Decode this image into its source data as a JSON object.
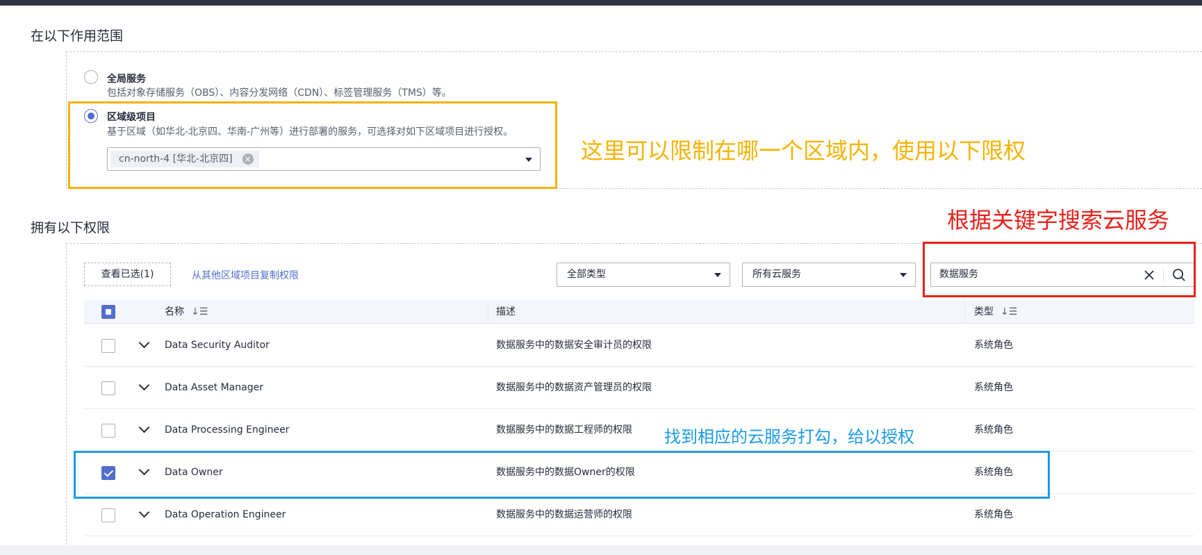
{
  "scope": {
    "title": "在以下作用范围",
    "global_option": {
      "title": "全局服务",
      "desc": "包括对象存储服务（OBS）、内容分发网络（CDN）、标签管理服务（TMS）等。",
      "selected": false
    },
    "region_option": {
      "title": "区域级项目",
      "desc": "基于区域（如华北-北京四、华南-广州等）进行部署的服务，可选择对如下区域项目进行授权。",
      "selected": true,
      "selected_tag": "cn-north-4 [华北-北京四]"
    }
  },
  "permissions": {
    "title": "拥有以下权限",
    "view_selected_button": "查看已选(1)",
    "copy_link": "从其他区域项目复制权限",
    "type_filter": "全部类型",
    "service_filter": "所有云服务",
    "search_value": "数据服务",
    "columns": {
      "name": "名称",
      "desc": "描述",
      "type": "类型"
    },
    "rows": [
      {
        "name": "Data Security Auditor",
        "desc": "数据服务中的数据安全审计员的权限",
        "type": "系统角色",
        "checked": false
      },
      {
        "name": "Data Asset Manager",
        "desc": "数据服务中的数据资产管理员的权限",
        "type": "系统角色",
        "checked": false
      },
      {
        "name": "Data Processing Engineer",
        "desc": "数据服务中的数据工程师的权限",
        "type": "系统角色",
        "checked": false
      },
      {
        "name": "Data Owner",
        "desc": "数据服务中的数据Owner的权限",
        "type": "系统角色",
        "checked": true
      },
      {
        "name": "Data Operation Engineer",
        "desc": "数据服务中的数据运营师的权限",
        "type": "系统角色",
        "checked": false
      }
    ]
  },
  "annotations": {
    "region_note": "这里可以限制在哪一个区域内，使用以下限权",
    "search_note": "根据关键字搜索云服务",
    "check_note": "找到相应的云服务打勾，给以授权",
    "colors": {
      "orange": "#f5b301",
      "red": "#e8201a",
      "blue": "#1a9ae6"
    }
  }
}
